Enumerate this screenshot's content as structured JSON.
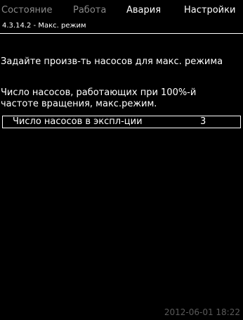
{
  "tabs": [
    {
      "label": "Состояние",
      "active": false
    },
    {
      "label": "Работа",
      "active": false
    },
    {
      "label": "Авария",
      "active": false
    },
    {
      "label": "Настройки",
      "active": true
    }
  ],
  "breadcrumb": "4.3.14.2 - Макс. режим",
  "instruction": "Задайте произв-ть насосов для макс. режима",
  "description": {
    "line1": "Число насосов, работающих при 100%-й",
    "line2": "частоте вращения, макс.режим."
  },
  "field": {
    "label": "Число насосов в экспл-ции",
    "value": "3"
  },
  "timestamp": "2012-06-01 18:22",
  "colors": {
    "background": "#000000",
    "active_text": "#ffffff",
    "inactive_tab": "#8a8a8a"
  }
}
